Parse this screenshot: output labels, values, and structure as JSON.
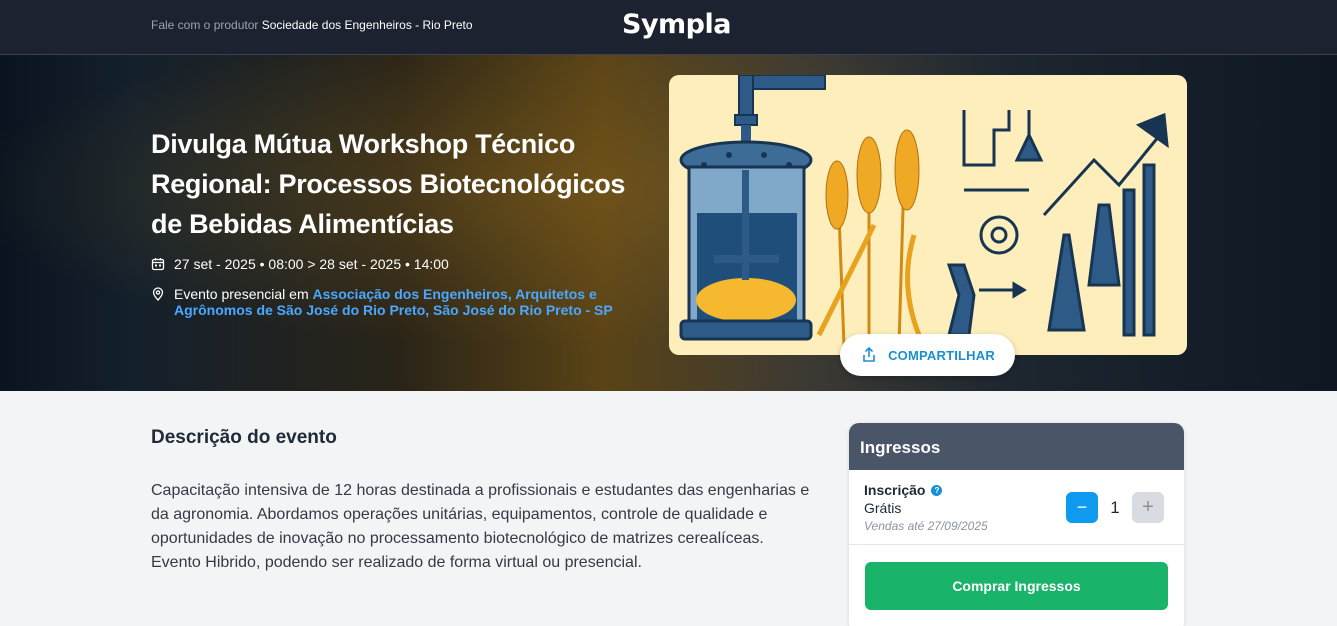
{
  "topbar": {
    "producer_prefix": "Fale com o produtor",
    "producer_name": "Sociedade dos Engenheiros - Rio Preto",
    "logo": "Sympla"
  },
  "event": {
    "title": "Divulga Mútua Workshop Técnico Regional: Processos Biotecnológicos de Bebidas Alimentícias",
    "date": "27 set - 2025 • 08:00 > 28 set - 2025 • 14:00",
    "location_prefix": "Evento presencial em",
    "location_link": "Associação dos Engenheiros, Arquitetos e Agrônomos de São José do Rio Preto, São José do Rio Preto - SP",
    "share_label": "COMPARTILHAR"
  },
  "description": {
    "heading": "Descrição do evento",
    "paragraph1": "Capacitação intensiva de 12 horas destinada a profissionais e estudantes das engenharias e da agronomia. Abordamos operações unitárias, equipamentos, controle de qualidade e oportunidades de inovação no processamento biotecnológico de matrizes cerealíceas.",
    "paragraph2": "Evento Hibrido, podendo ser realizado de forma virtual ou presencial."
  },
  "tickets": {
    "heading": "Ingressos",
    "item": {
      "name": "Inscrição",
      "price": "Grátis",
      "sales_until": "Vendas até 27/09/2025",
      "quantity": "1",
      "minus": "−",
      "plus": "+"
    },
    "buy_label": "Comprar Ingressos"
  },
  "icons": [
    "calendar-icon",
    "location-pin-icon",
    "share-icon",
    "help-icon",
    "minus-icon",
    "plus-icon"
  ],
  "colors": {
    "topbar": "#1c2230",
    "link": "#4aa8ff",
    "accent_blue": "#0f9af0",
    "buy_green": "#1ab36a",
    "ticket_header": "#4a5568",
    "banner_bg": "#fdeebb"
  }
}
